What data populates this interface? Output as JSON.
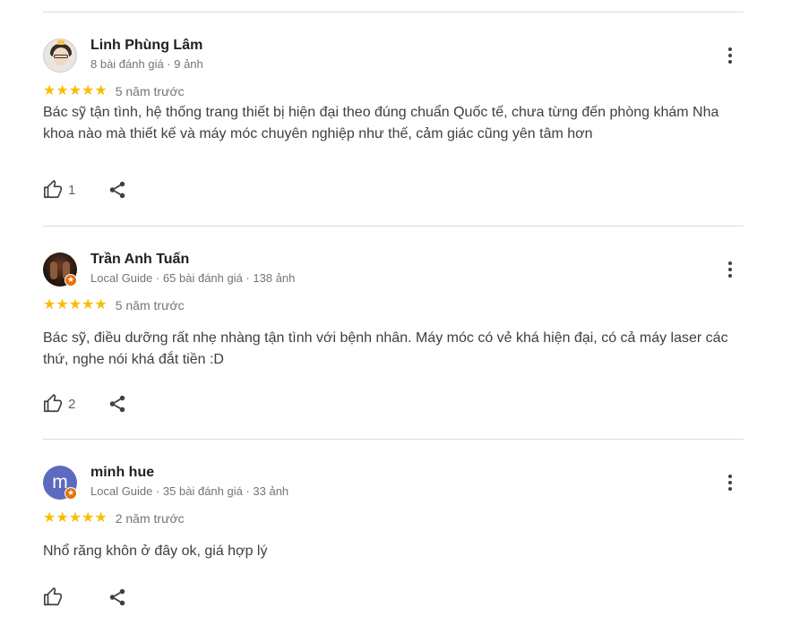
{
  "reviews": [
    {
      "name": "Linh Phùng Lâm",
      "meta": "8 bài đánh giá · 9 ảnh",
      "stars": "★★★★★",
      "rating": 5,
      "time": "5 năm trước",
      "text": "Bác sỹ tận tình, hệ thống trang thiết bị hiện đại theo đúng chuẩn Quốc tế, chưa từng đến phòng khám Nha khoa nào mà thiết kế và máy móc chuyên nghiệp như thế, cảm giác cũng yên tâm hơn",
      "likes": "1"
    },
    {
      "name": "Trần Anh Tuấn",
      "meta": "Local Guide · 65 bài đánh giá · 138 ảnh",
      "stars": "★★★★★",
      "rating": 5,
      "time": "5 năm trước",
      "text": "Bác sỹ, điều dưỡng rất nhẹ nhàng tận tình với bệnh nhân. Máy móc có vẻ khá hiện đại, có cả máy laser các thứ, nghe nói khá đắt tiền :D",
      "likes": "2"
    },
    {
      "name": "minh hue",
      "avatar_letter": "m",
      "meta": "Local Guide · 35 bài đánh giá · 33 ảnh",
      "stars": "★★★★★",
      "rating": 5,
      "time": "2 năm trước",
      "text": "Nhổ răng khôn ở đây ok, giá hợp lý",
      "likes": ""
    }
  ],
  "icons": {
    "like": "thumbs-up-icon",
    "share": "share-icon",
    "more": "more-vert-icon",
    "local_guide": "local-guide-badge-icon"
  },
  "colors": {
    "star": "#fbbc04",
    "avatar_letter_bg": "#5c6bc0",
    "guide_badge": "#e8710a",
    "divider": "#dadce0"
  }
}
